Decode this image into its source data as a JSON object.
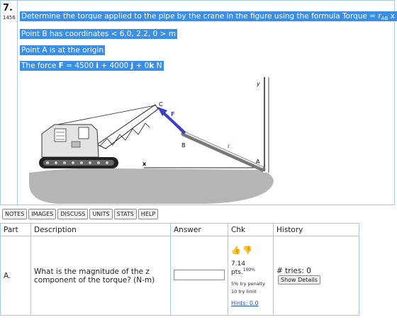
{
  "problem": {
    "number": "7.",
    "id": "1456",
    "lines": [
      "Determine the torque applied to the pipe by the crane in the figure using the formula Torque = r",
      "Point B has coordinates < 6.0, 2.2, 0 > m",
      "Point A is at the origin",
      "The force "
    ],
    "torque_sub": "AB",
    "torque_tail": " x F",
    "force_bold_F": "F",
    "force_mid1": " = 4500 ",
    "force_i": "i",
    "force_mid2": " + 4000 ",
    "force_j": "j",
    "force_mid3": " + 0",
    "force_k": "k",
    "force_tail": " N"
  },
  "figure": {
    "labels": {
      "C": "C",
      "F": "F",
      "B": "B",
      "r": "r",
      "A": "A",
      "x": "x",
      "y": "y"
    },
    "colors": {
      "force_arrow": "#3b3fc4",
      "ground": "#a9a9a9",
      "crane": "#e0e0e0"
    }
  },
  "tabs": [
    "NOTES",
    "IMAGES",
    "DISCUSS",
    "UNITS",
    "STATS",
    "HELP"
  ],
  "table": {
    "headers": [
      "Part",
      "Description",
      "Answer",
      "Chk",
      "History"
    ],
    "row": {
      "part": "A.",
      "description": "What is the magnitude of the z component of the torque? (N-m)",
      "answer_value": "",
      "pts": "7.14 pts.",
      "pts_pct": "100%",
      "penalty": "5% try penalty",
      "limit": "10 try limit",
      "hints": "Hints: 0.0",
      "tries_label": "# tries: 0",
      "show_details": "Show Details"
    }
  }
}
